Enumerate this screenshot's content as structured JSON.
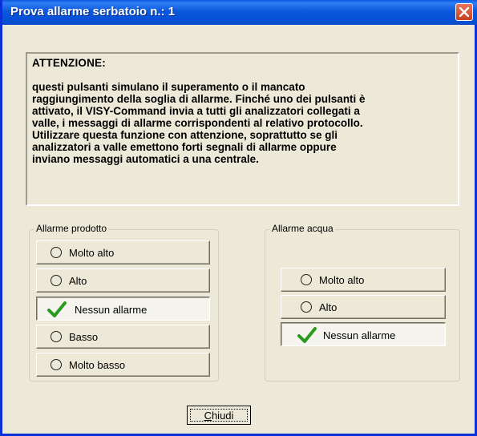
{
  "window": {
    "title": "Prova allarme serbatoio n.: 1",
    "close_icon": "close-x-icon",
    "accent_color": "#0a5be0"
  },
  "warning": {
    "heading": "ATTENZIONE:",
    "lines": [
      "questi pulsanti simulano il superamento o il mancato",
      "raggiungimento della soglia di allarme. Finché uno dei pulsanti è",
      "attivato, il VISY-Command invia a tutti gli analizzatori collegati a",
      "valle, i messaggi di allarme corrispondenti al relativo protocollo.",
      "Utilizzare questa funzione con attenzione, soprattutto se gli",
      "analizzatori a valle emettono forti segnali di allarme oppure",
      "inviano messaggi automatici a una centrale."
    ]
  },
  "product_group": {
    "legend": "Allarme prodotto",
    "options": [
      {
        "label": "Molto alto",
        "selected": false
      },
      {
        "label": "Alto",
        "selected": false
      },
      {
        "label": "Nessun allarme",
        "selected": true
      },
      {
        "label": "Basso",
        "selected": false
      },
      {
        "label": "Molto basso",
        "selected": false
      }
    ]
  },
  "water_group": {
    "legend": "Allarme acqua",
    "options": [
      {
        "label": "Molto alto",
        "selected": false
      },
      {
        "label": "Alto",
        "selected": false
      },
      {
        "label": "Nessun allarme",
        "selected": true
      }
    ]
  },
  "footer": {
    "close_label_mnemonic": "C",
    "close_label_rest": "hiudi"
  },
  "icons": {
    "unselected": "radio-circle-icon",
    "selected": "green-check-icon",
    "check_color": "#2a9a1f"
  }
}
